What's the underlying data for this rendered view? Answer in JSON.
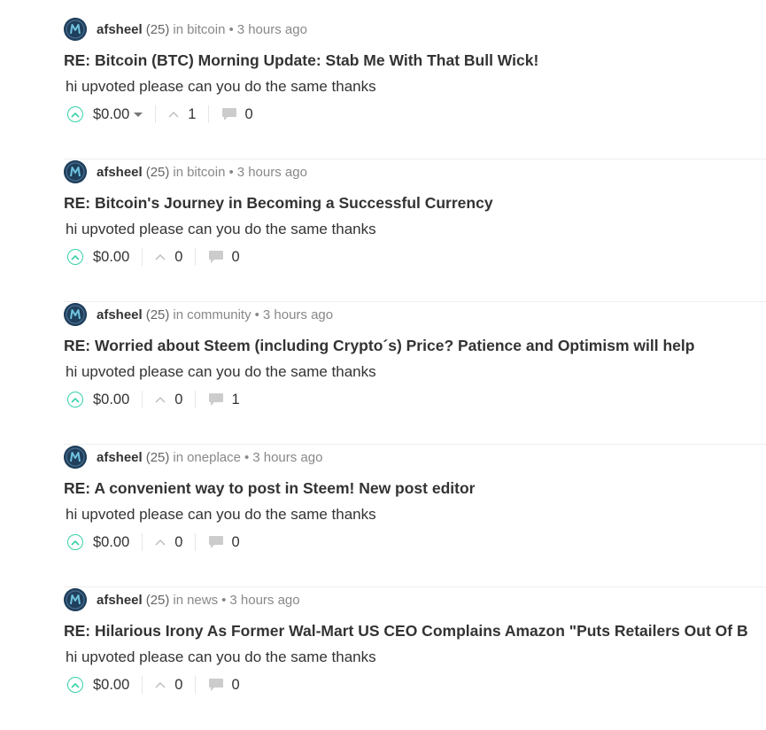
{
  "colors": {
    "upvote_accent": "#36d1a8",
    "avatar_bg": "#1f3f5c",
    "text": "#333333",
    "muted": "#888888"
  },
  "posts": [
    {
      "author": "afsheel",
      "rep": "(25)",
      "in": "in",
      "community": "bitcoin",
      "dot": "•",
      "time": "3 hours ago",
      "title": "RE: Bitcoin (BTC) Morning Update: Stab Me With That Bull Wick!",
      "body": "hi upvoted please can you do the same thanks",
      "payout": "$0.00",
      "votes": "1",
      "comments": "0"
    },
    {
      "author": "afsheel",
      "rep": "(25)",
      "in": "in",
      "community": "bitcoin",
      "dot": "•",
      "time": "3 hours ago",
      "title": "RE: Bitcoin's Journey in Becoming a Successful Currency",
      "body": "hi upvoted please can you do the same thanks",
      "payout": "$0.00",
      "votes": "0",
      "comments": "0"
    },
    {
      "author": "afsheel",
      "rep": "(25)",
      "in": "in",
      "community": "community",
      "dot": "•",
      "time": "3 hours ago",
      "title": "RE: Worried about Steem (including Crypto´s) Price? Patience and Optimism will help",
      "body": "hi upvoted please can you do the same thanks",
      "payout": "$0.00",
      "votes": "0",
      "comments": "1"
    },
    {
      "author": "afsheel",
      "rep": "(25)",
      "in": "in",
      "community": "oneplace",
      "dot": "•",
      "time": "3 hours ago",
      "title": "RE: A convenient way to post in Steem! New post editor",
      "body": "hi upvoted please can you do the same thanks",
      "payout": "$0.00",
      "votes": "0",
      "comments": "0"
    },
    {
      "author": "afsheel",
      "rep": "(25)",
      "in": "in",
      "community": "news",
      "dot": "•",
      "time": "3 hours ago",
      "title": "RE: Hilarious Irony As Former Wal-Mart US CEO Complains Amazon \"Puts Retailers Out Of B",
      "body": "hi upvoted please can you do the same thanks",
      "payout": "$0.00",
      "votes": "0",
      "comments": "0"
    }
  ]
}
